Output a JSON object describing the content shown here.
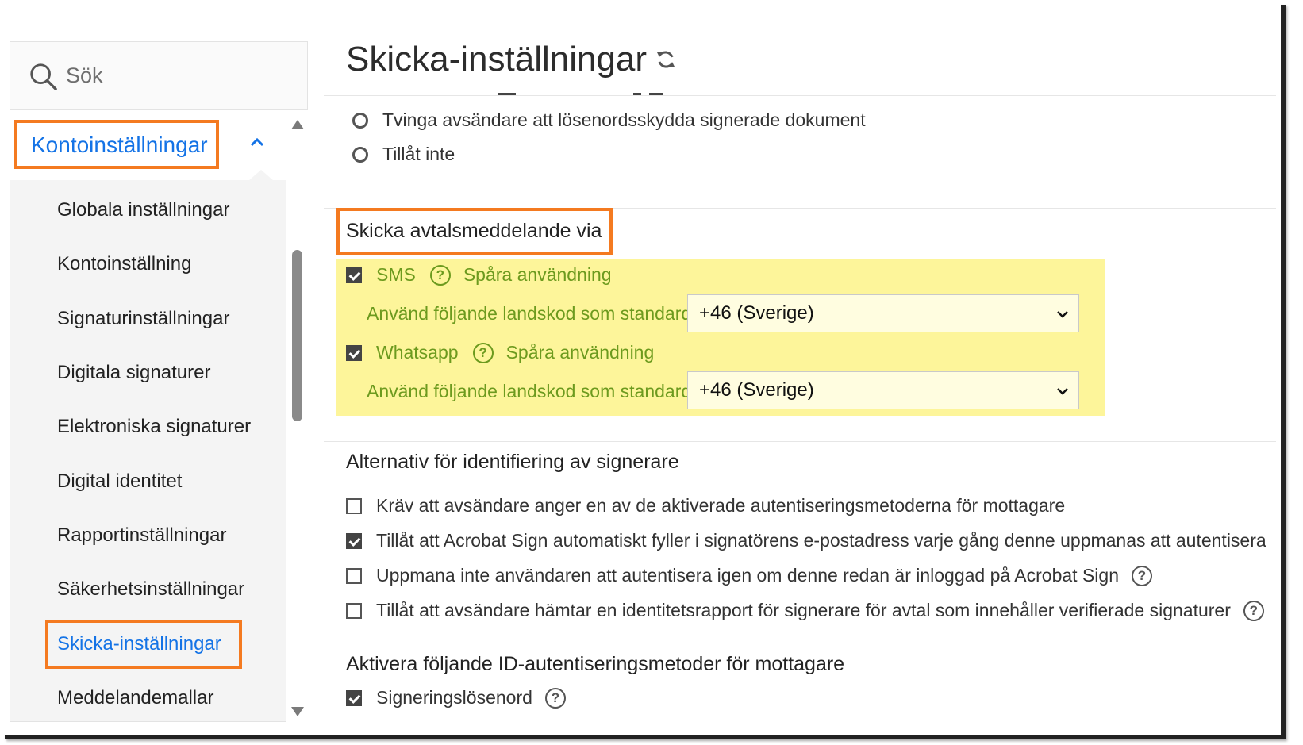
{
  "search": {
    "placeholder": "Sök"
  },
  "sidebar": {
    "section_label": "Kontoinställningar",
    "items": [
      {
        "label": "Globala inställningar"
      },
      {
        "label": "Kontoinställning"
      },
      {
        "label": "Signaturinställningar"
      },
      {
        "label": "Digitala signaturer"
      },
      {
        "label": "Elektroniska signaturer"
      },
      {
        "label": "Digital identitet"
      },
      {
        "label": "Rapportinställningar"
      },
      {
        "label": "Säkerhetsinställningar"
      },
      {
        "label": "Skicka-inställningar",
        "active": true
      },
      {
        "label": "Meddelandemallar"
      }
    ]
  },
  "main": {
    "title": "Skicka-inställningar",
    "password_options": [
      "Tvinga avsändare att lösenordsskydda signerade dokument",
      "Tillåt inte"
    ],
    "notify": {
      "heading": "Skicka avtalsmeddelande via",
      "sms_label": "SMS",
      "whatsapp_label": "Whatsapp",
      "track_usage": "Spåra användning",
      "country_code_label": "Använd följande landskod som standard:",
      "sms_country_code": "+46 (Sverige)",
      "whatsapp_country_code": "+46 (Sverige)"
    },
    "identification": {
      "heading": "Alternativ för identifiering av signerare",
      "options": [
        {
          "label": "Kräv att avsändare anger en av de aktiverade autentiseringsmetoderna för mottagare",
          "checked": false
        },
        {
          "label": "Tillåt att Acrobat Sign automatiskt fyller i signatörens e-postadress varje gång denne uppmanas att autentisera",
          "checked": true
        },
        {
          "label": "Uppmana inte användaren att autentisera igen om denne redan är inloggad på Acrobat Sign",
          "checked": false
        },
        {
          "label": "Tillåt att avsändare hämtar en identitetsrapport för signerare för avtal som innehåller verifierade signaturer",
          "checked": false
        }
      ]
    },
    "id_methods": {
      "heading": "Aktivera följande ID-autentiseringsmetoder för mottagare",
      "first_option": "Signeringslösenord"
    }
  },
  "colors": {
    "accent_blue": "#1473e6",
    "highlight_orange": "#f47a20",
    "highlight_yellow": "#fdf59a",
    "link_green": "#6c9a1e"
  }
}
